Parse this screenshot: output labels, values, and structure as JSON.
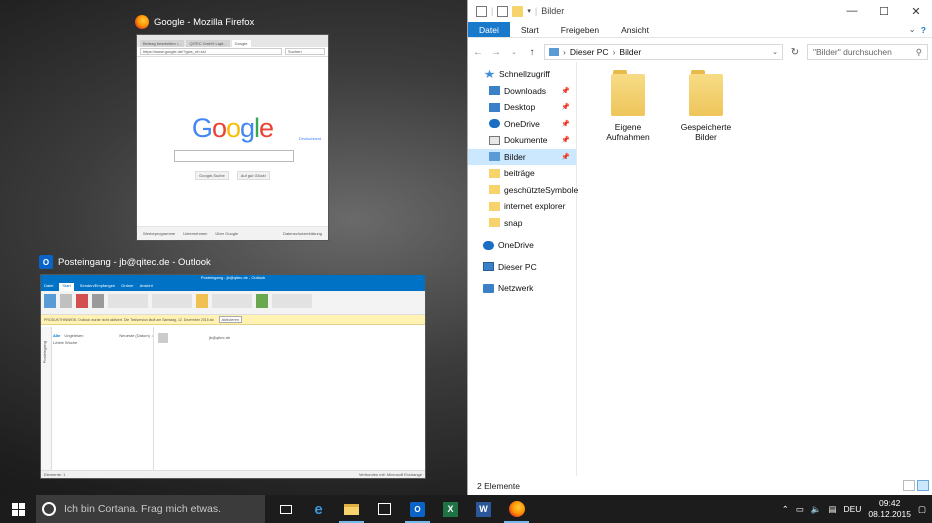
{
  "firefox_window": {
    "title": "Google - Mozilla Firefox",
    "tabs": [
      "Beitrag bearbeiten ‹...",
      "QITEC GmbH Lapt...",
      "Google"
    ],
    "url": "https://www.google.de/?gws_rd=ssl",
    "search_placeholder": "Suchen",
    "google_logo": "Google",
    "google_sub": "Deutschland",
    "btn_search": "Google-Suche",
    "btn_lucky": "Auf gut Glück!",
    "footer_left": [
      "Werbeprogramme",
      "Unternehmen",
      "Über Google"
    ],
    "footer_right": "Datenschutzerklärung"
  },
  "outlook_window": {
    "title": "Posteingang - jb@qitec.de - Outlook",
    "window_caption": "Posteingang - jb@qitec.de - Outlook",
    "ribbon_tabs": [
      "Datei",
      "Start",
      "Senden/Empfangen",
      "Ordner",
      "Ansicht"
    ],
    "notice": "PRODUKTHINWEIS: Outlook wurde nicht aktiviert. Die Testversion läuft am Samstag, 12. Dezember 2015 ab.",
    "notice_button": "Aktivieren",
    "filter_all": "Alle",
    "filter_unread": "Ungelesen",
    "sort": "Neueste (Datum) ↓",
    "group": "Letzte Woche",
    "folder_label": "Posteingang",
    "reading_from": "jb@qitec.de",
    "status_left": "Elemente: 1",
    "status_right": "Verbunden mit: Microsoft Exchange"
  },
  "explorer": {
    "title": "Bilder",
    "ribbon_tabs": [
      "Datei",
      "Start",
      "Freigeben",
      "Ansicht"
    ],
    "address": [
      "Dieser PC",
      "Bilder"
    ],
    "search_placeholder": "\"Bilder\" durchsuchen",
    "nav": [
      {
        "label": "Schnellzugriff",
        "icon": "star-icon",
        "pinned": false
      },
      {
        "label": "Downloads",
        "icon": "download-icon",
        "pinned": true
      },
      {
        "label": "Desktop",
        "icon": "desktop-icon",
        "pinned": true
      },
      {
        "label": "OneDrive",
        "icon": "cloud-icon",
        "pinned": true
      },
      {
        "label": "Dokumente",
        "icon": "document-icon",
        "pinned": true
      },
      {
        "label": "Bilder",
        "icon": "pictures-icon",
        "pinned": true,
        "selected": true
      },
      {
        "label": "beiträge",
        "icon": "folder-icon",
        "pinned": false
      },
      {
        "label": "geschützteSymbole",
        "icon": "folder-icon",
        "pinned": false
      },
      {
        "label": "internet explorer",
        "icon": "folder-icon",
        "pinned": false
      },
      {
        "label": "snap",
        "icon": "folder-icon",
        "pinned": false
      }
    ],
    "nav_roots": [
      {
        "label": "OneDrive",
        "icon": "cloud-icon"
      },
      {
        "label": "Dieser PC",
        "icon": "computer-icon"
      },
      {
        "label": "Netzwerk",
        "icon": "network-icon"
      }
    ],
    "items": [
      {
        "line1": "Eigene",
        "line2": "Aufnahmen"
      },
      {
        "line1": "Gespeicherte",
        "line2": "Bilder"
      }
    ],
    "status": "2 Elemente"
  },
  "taskbar": {
    "cortana_placeholder": "Ich bin Cortana. Frag mich etwas.",
    "lang": "DEU",
    "time": "09:42",
    "date": "08.12.2015"
  },
  "colors": {
    "accent": "#1979ca",
    "selection": "#cce8ff",
    "taskbar": "#1c1c1c",
    "folder": "#f6d36b"
  }
}
